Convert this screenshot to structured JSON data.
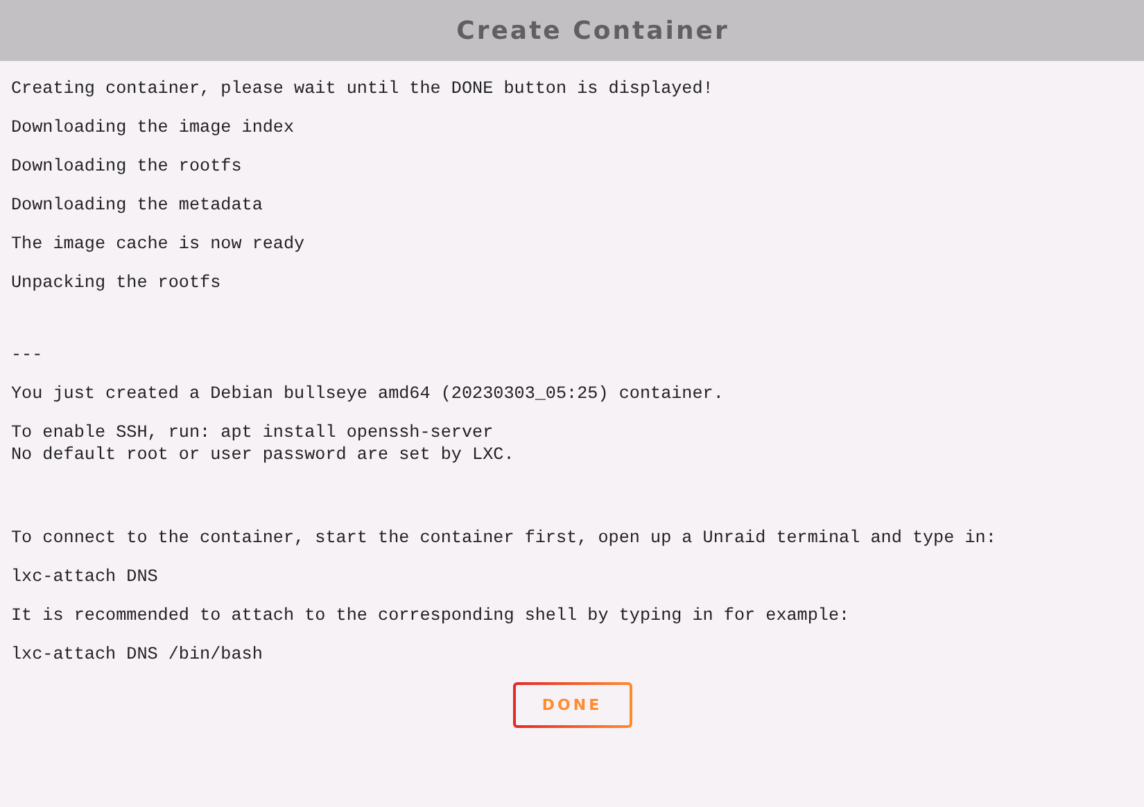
{
  "window": {
    "title": "Create Container"
  },
  "log": [
    {
      "kind": "paragraph",
      "lines": [
        "Creating container, please wait until the DONE button is displayed!"
      ]
    },
    {
      "kind": "paragraph",
      "lines": [
        "Downloading the image index"
      ]
    },
    {
      "kind": "paragraph",
      "lines": [
        "Downloading the rootfs"
      ]
    },
    {
      "kind": "paragraph",
      "lines": [
        "Downloading the metadata"
      ]
    },
    {
      "kind": "paragraph",
      "lines": [
        "The image cache is now ready"
      ]
    },
    {
      "kind": "paragraph",
      "lines": [
        "Unpacking the rootfs"
      ]
    },
    {
      "kind": "separator",
      "lines": [
        "---"
      ]
    },
    {
      "kind": "paragraph",
      "lines": [
        "You just created a Debian bullseye amd64 (20230303_05:25) container."
      ]
    },
    {
      "kind": "paragraph",
      "lines": [
        "To enable SSH, run: apt install openssh-server",
        "No default root or user password are set by LXC."
      ]
    },
    {
      "kind": "section",
      "lines": [
        "To connect to the container, start the container first, open up a Unraid terminal and type in:"
      ]
    },
    {
      "kind": "paragraph",
      "lines": [
        "lxc-attach DNS"
      ]
    },
    {
      "kind": "paragraph",
      "lines": [
        "It is recommended to attach to the corresponding shell by typing in for example:"
      ]
    },
    {
      "kind": "paragraph",
      "lines": [
        "lxc-attach DNS /bin/bash"
      ]
    }
  ],
  "done_button": {
    "label": "DONE"
  }
}
